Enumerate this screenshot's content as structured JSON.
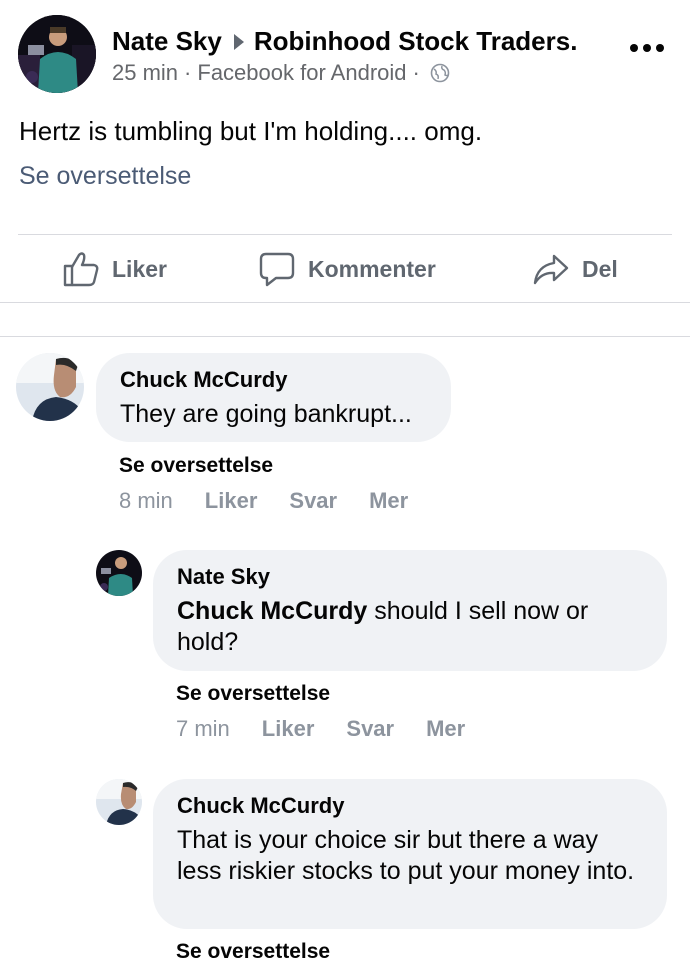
{
  "post": {
    "author": "Nate Sky",
    "group": "Robinhood Stock Traders.",
    "time": "25 min",
    "source": "Facebook for Android",
    "separator": "·",
    "text": "Hertz is tumbling but I'm holding.... omg.",
    "translate_label": "Se oversettelse",
    "audience_icon": "globe-icon",
    "more_icon": "more-options-icon"
  },
  "actions": {
    "like": "Liker",
    "comment": "Kommenter",
    "share": "Del"
  },
  "comments": [
    {
      "author": "Chuck McCurdy",
      "text": "They are going bankrupt...",
      "translate": "Se oversettelse",
      "time": "8 min",
      "like": "Liker",
      "reply": "Svar",
      "more": "Mer"
    },
    {
      "author": "Nate Sky",
      "mention": "Chuck McCurdy",
      "text": " should I sell now or hold?",
      "translate": "Se oversettelse",
      "time": "7 min",
      "like": "Liker",
      "reply": "Svar",
      "more": "Mer"
    },
    {
      "author": "Chuck McCurdy",
      "text": "That is your choice sir but there a way less riskier stocks to put your money into.",
      "translate": "Se oversettelse"
    }
  ],
  "colors": {
    "bubble": "#f0f2f5",
    "meta_text": "#65676b",
    "action_text": "#606770",
    "link_text": "#4b5b75",
    "divider": "#d9dadf"
  }
}
